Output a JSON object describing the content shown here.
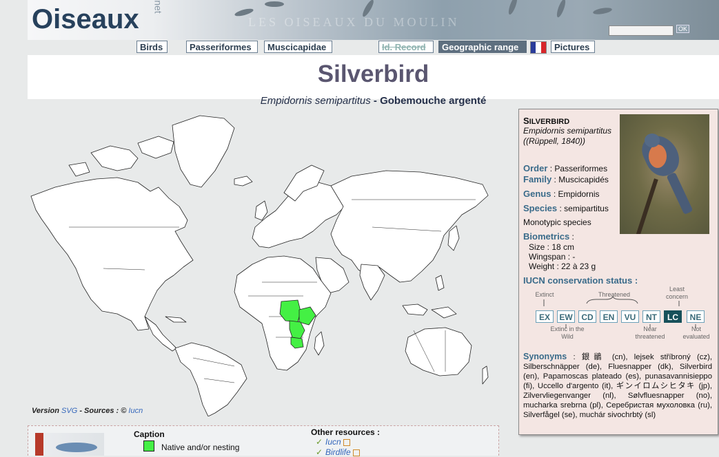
{
  "header": {
    "logo": "Oiseaux",
    "logo_suffix": ".net",
    "banner_text": "LES OISEAUX DU MOULIN",
    "search": {
      "value": "",
      "button": "OK"
    }
  },
  "nav": {
    "birds": "Birds",
    "order": "Passeriformes",
    "family": "Muscicapidae",
    "id_record": "Id. Record",
    "geo_range": "Geographic range",
    "pictures": "Pictures",
    "flag_colors": [
      "#2a3c9a",
      "#ffffff",
      "#d8262a"
    ]
  },
  "page": {
    "title": "Silverbird",
    "sci_name": "Empidornis semipartitus",
    "separator": " - ",
    "french_name": "Gobemouche argenté"
  },
  "map": {
    "highlight_color": "#44f044",
    "version_label": "Version",
    "version_link": "SVG",
    "sources_label": "- Sources : ©",
    "sources_link": "Iucn"
  },
  "caption": {
    "title": "Caption",
    "native_label": "Native and/or nesting"
  },
  "resources": {
    "title": "Other resources :",
    "items": [
      "Iucn",
      "Birdlife"
    ]
  },
  "info": {
    "name_first": "S",
    "name_rest": "ILVERBIRD",
    "sci": "Empidornis semipartitus",
    "author": "((Rüppell, 1840))",
    "order_label": "Order",
    "order_value": ": Passeriformes",
    "family_label": "Family",
    "family_value": ": Muscicapidés",
    "genus_label": "Genus",
    "genus_value": ": Empidornis",
    "species_label": "Species",
    "species_value": ": semipartitus",
    "monotypic": "Monotypic species",
    "biometrics_label": "Biometrics",
    "biometrics_colon": " :",
    "size": "Size : 18 cm",
    "wingspan": "Wingspan : -",
    "weight": "Weight : 22 à 23 g",
    "iucn_label": "IUCN conservation status :",
    "iucn_categories": [
      "EX",
      "EW",
      "CD",
      "EN",
      "VU",
      "NT",
      "LC",
      "NE"
    ],
    "iucn_selected": "LC",
    "notes": {
      "extinct": "Extinct",
      "threatened": "Threatened",
      "least_concern": "Least concern",
      "extinct_wild": "Extinc in the Wild",
      "near_threatened": "Near threatened",
      "not_evaluated": "Not evaluated"
    },
    "synonyms_label": "Synonyms",
    "synonyms_text": ": 銀鶲 (cn), lejsek stříbroný (cz), Silberschnäpper (de), Fluesnapper (dk), Silverbird (en), Papamoscas plateado (es), punasavannisieppo (fi), Uccello d'argento (it), ギンイロムシヒタキ (jp), Zilvervliegenvanger (nl), Sølvfluesnapper (no), mucharka srebrna (pl), Серебристая мухоловка (ru), Silverfågel (se), muchár sivochrbtý (sl)"
  }
}
